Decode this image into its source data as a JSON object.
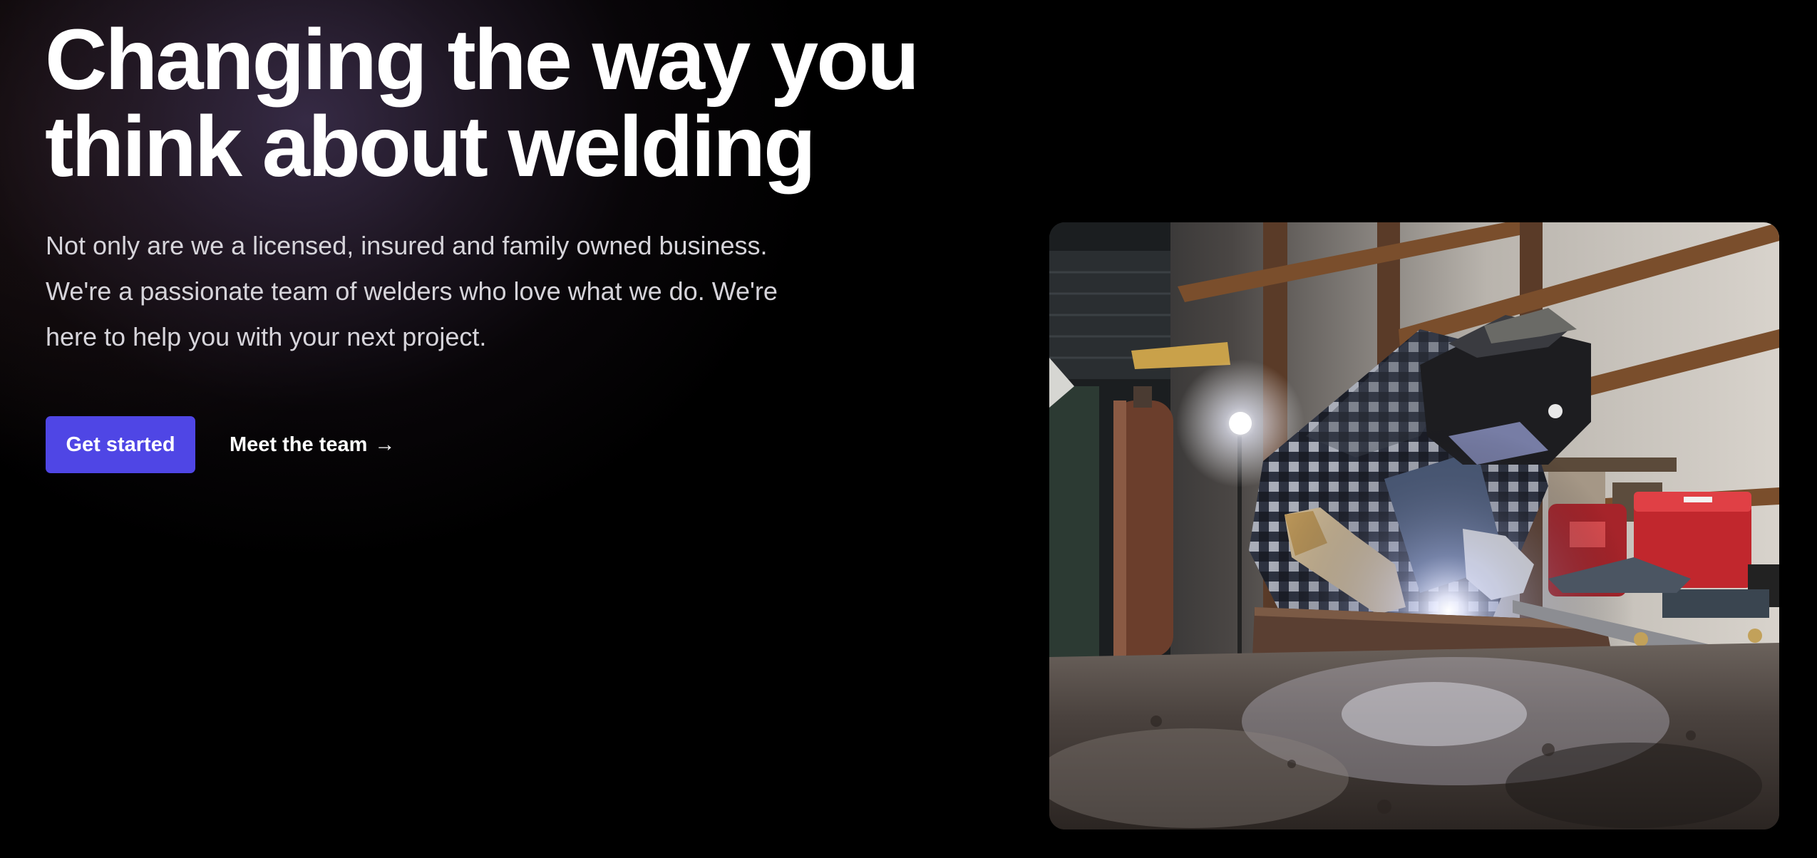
{
  "hero": {
    "title_line1": "Changing the way you",
    "title_line2": "think about welding",
    "lead_line1": "Not only are we a licensed, insured and family owned business.",
    "lead_line2": "We're a passionate team of welders who love what we do. We're",
    "lead_line3": "here to help you with your next project.",
    "primary_cta": "Get started",
    "secondary_cta": "Meet the team",
    "secondary_cta_arrow": "→"
  },
  "colors": {
    "background": "#000000",
    "accent": "#4f46e5",
    "text": "#ffffff",
    "muted_text": "#d6d4da"
  }
}
